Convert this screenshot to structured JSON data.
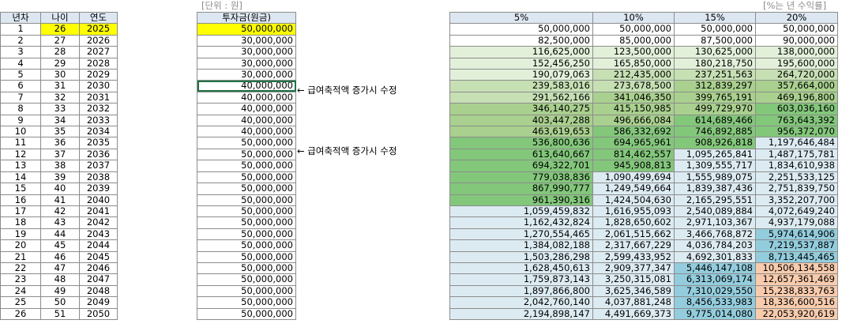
{
  "unit_label": "[단위 : 원]",
  "rate_label": "[%는 년 수익률]",
  "left_table": {
    "headers": [
      "년차",
      "나이",
      "연도"
    ],
    "rows": [
      [
        "1",
        "26",
        "2025"
      ],
      [
        "2",
        "27",
        "2026"
      ],
      [
        "3",
        "28",
        "2027"
      ],
      [
        "4",
        "29",
        "2028"
      ],
      [
        "5",
        "30",
        "2029"
      ],
      [
        "6",
        "31",
        "2030"
      ],
      [
        "7",
        "32",
        "2031"
      ],
      [
        "8",
        "33",
        "2032"
      ],
      [
        "9",
        "34",
        "2033"
      ],
      [
        "10",
        "35",
        "2034"
      ],
      [
        "11",
        "36",
        "2035"
      ],
      [
        "12",
        "37",
        "2036"
      ],
      [
        "13",
        "38",
        "2037"
      ],
      [
        "14",
        "39",
        "2038"
      ],
      [
        "15",
        "40",
        "2039"
      ],
      [
        "16",
        "41",
        "2040"
      ],
      [
        "17",
        "42",
        "2041"
      ],
      [
        "18",
        "43",
        "2042"
      ],
      [
        "19",
        "44",
        "2043"
      ],
      [
        "20",
        "45",
        "2044"
      ],
      [
        "21",
        "46",
        "2045"
      ],
      [
        "22",
        "47",
        "2046"
      ],
      [
        "23",
        "48",
        "2047"
      ],
      [
        "24",
        "49",
        "2048"
      ],
      [
        "25",
        "50",
        "2049"
      ],
      [
        "26",
        "51",
        "2050"
      ]
    ]
  },
  "invest": {
    "header": "투자금(원금)",
    "values": [
      "50,000,000",
      "30,000,000",
      "30,000,000",
      "30,000,000",
      "30,000,000",
      "40,000,000",
      "40,000,000",
      "40,000,000",
      "40,000,000",
      "40,000,000",
      "50,000,000",
      "50,000,000",
      "50,000,000",
      "50,000,000",
      "50,000,000",
      "50,000,000",
      "50,000,000",
      "50,000,000",
      "50,000,000",
      "50,000,000",
      "50,000,000",
      "50,000,000",
      "50,000,000",
      "50,000,000",
      "50,000,000",
      "50,000,000"
    ]
  },
  "notes": [
    {
      "row": 6,
      "text": "← 급여축적액 증가시 수정"
    },
    {
      "row": 11,
      "text": "← 급여축적액 증가시 수정"
    }
  ],
  "returns": {
    "headers": [
      "5%",
      "10%",
      "15%",
      "20%"
    ],
    "rows": [
      [
        "50,000,000",
        "50,000,000",
        "50,000,000",
        "50,000,000"
      ],
      [
        "82,500,000",
        "85,000,000",
        "87,500,000",
        "90,000,000"
      ],
      [
        "116,625,000",
        "123,500,000",
        "130,625,000",
        "138,000,000"
      ],
      [
        "152,456,250",
        "165,850,000",
        "180,218,750",
        "195,600,000"
      ],
      [
        "190,079,063",
        "212,435,000",
        "237,251,563",
        "264,720,000"
      ],
      [
        "239,583,016",
        "273,678,500",
        "312,839,297",
        "357,664,000"
      ],
      [
        "291,562,166",
        "341,046,350",
        "399,765,191",
        "469,196,800"
      ],
      [
        "346,140,275",
        "415,150,985",
        "499,729,970",
        "603,036,160"
      ],
      [
        "403,447,288",
        "496,666,084",
        "614,689,466",
        "763,643,392"
      ],
      [
        "463,619,653",
        "586,332,692",
        "746,892,885",
        "956,372,070"
      ],
      [
        "536,800,636",
        "694,965,961",
        "908,926,818",
        "1,197,646,484"
      ],
      [
        "613,640,667",
        "814,462,557",
        "1,095,265,841",
        "1,487,175,781"
      ],
      [
        "694,322,701",
        "945,908,813",
        "1,309,555,717",
        "1,834,610,938"
      ],
      [
        "779,038,836",
        "1,090,499,694",
        "1,555,989,075",
        "2,251,533,125"
      ],
      [
        "867,990,777",
        "1,249,549,664",
        "1,839,387,436",
        "2,751,839,750"
      ],
      [
        "961,390,316",
        "1,424,504,630",
        "2,165,295,551",
        "3,352,207,700"
      ],
      [
        "1,059,459,832",
        "1,616,955,093",
        "2,540,089,884",
        "4,072,649,240"
      ],
      [
        "1,162,432,824",
        "1,828,650,602",
        "2,971,103,367",
        "4,937,179,088"
      ],
      [
        "1,270,554,465",
        "2,061,515,662",
        "3,466,768,872",
        "5,974,614,906"
      ],
      [
        "1,384,082,188",
        "2,317,667,229",
        "4,036,784,203",
        "7,219,537,887"
      ],
      [
        "1,503,286,298",
        "2,599,433,952",
        "4,692,301,833",
        "8,713,445,465"
      ],
      [
        "1,628,450,613",
        "2,909,377,347",
        "5,446,147,108",
        "10,506,134,558"
      ],
      [
        "1,759,873,143",
        "3,250,315,081",
        "6,313,069,174",
        "12,657,361,469"
      ],
      [
        "1,897,866,800",
        "3,625,346,589",
        "7,310,029,550",
        "15,238,833,763"
      ],
      [
        "2,042,760,140",
        "4,037,881,248",
        "8,456,533,983",
        "18,336,600,516"
      ],
      [
        "2,194,898,147",
        "4,491,669,373",
        "9,775,014,080",
        "22,053,920,619"
      ]
    ]
  },
  "colors": {
    "header_bg": "#dde7f2",
    "highlight": "#ffff00",
    "band_100m": "#e2f0d9",
    "band_200m": "#c6e0b4",
    "band_300m": "#a9d08e",
    "band_500m": "#83c77b",
    "band_1b": "#dcebf2",
    "band_5b": "#93cddd",
    "band_10b": "#f8cbad"
  }
}
